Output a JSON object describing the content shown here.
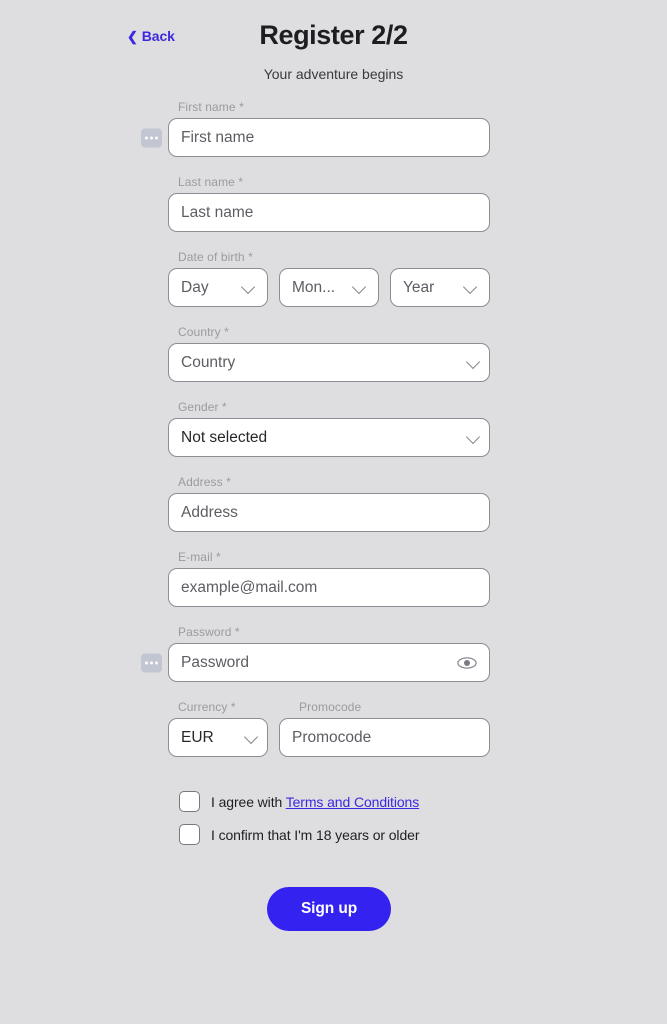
{
  "header": {
    "back_label": "Back",
    "back_icon": "chevron-left-icon",
    "title": "Register 2/2",
    "subtitle": "Your adventure begins"
  },
  "colors": {
    "background": "#dedee0",
    "accent": "#3322f0",
    "link": "#3b28e0",
    "field_border": "#8d8d93",
    "label": "#9a9aa0",
    "placeholder": "#5d5d63"
  },
  "form": {
    "first_name": {
      "label": "First name *",
      "placeholder": "First name",
      "value": ""
    },
    "last_name": {
      "label": "Last name *",
      "placeholder": "Last name",
      "value": ""
    },
    "date_of_birth": {
      "label": "Date of birth *",
      "day": "Day",
      "month": "Mon...",
      "year": "Year"
    },
    "country": {
      "label": "Country *",
      "value": "Country"
    },
    "gender": {
      "label": "Gender *",
      "value": "Not selected"
    },
    "address": {
      "label": "Address *",
      "placeholder": "Address",
      "value": ""
    },
    "email": {
      "label": "E-mail *",
      "placeholder": "example@mail.com",
      "value": ""
    },
    "password": {
      "label": "Password *",
      "placeholder": "Password",
      "value": "",
      "reveal_icon": "eye-icon"
    },
    "currency": {
      "label": "Currency *",
      "value": "EUR"
    },
    "promocode": {
      "label": "Promocode",
      "placeholder": "Promocode",
      "value": ""
    }
  },
  "agreements": {
    "terms": {
      "text_before": "I agree with ",
      "link_text": "Terms and Conditions",
      "checked": false
    },
    "age": {
      "text": "I confirm that I'm 18 years or older",
      "checked": false
    }
  },
  "submit": {
    "label": "Sign up"
  },
  "autofill_badge": {
    "icon": "autofill-dots-icon"
  }
}
